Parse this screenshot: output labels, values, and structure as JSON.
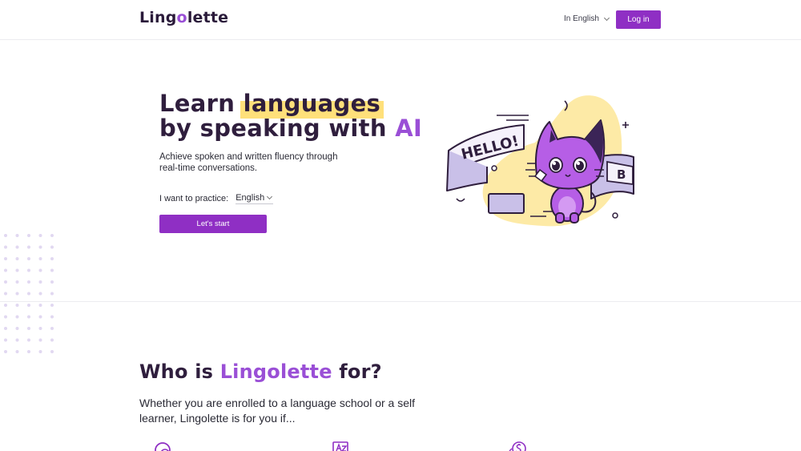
{
  "header": {
    "logo": {
      "before": "Ling",
      "accent": "o",
      "after": "lette"
    },
    "language_label": "In English",
    "login_label": "Log in"
  },
  "hero": {
    "title_learn": "Learn",
    "title_highlight": "languages",
    "title_line2": "by speaking with",
    "title_ai": "AI",
    "subtitle": "Achieve spoken and written fluency through real-time conversations.",
    "practice_label": "I want to practice:",
    "practice_value": "English",
    "cta_label": "Let's start"
  },
  "mascot": {
    "speech_text": "HELLO!",
    "letter_text": "B"
  },
  "who": {
    "title_before": "Who is",
    "title_accent": "Lingolette",
    "title_after": "for?",
    "text": "Whether you are enrolled to a language school or a self learner, Lingolette is for you if..."
  },
  "features": {
    "icons": [
      "clock-icon",
      "translate-icon",
      "dollar-icon"
    ]
  },
  "colors": {
    "brand_purple": "#8f2fc4",
    "accent_purple": "#9a4fd6",
    "highlight_yellow": "#ffe07a",
    "dark_text": "#2f1e3d"
  }
}
